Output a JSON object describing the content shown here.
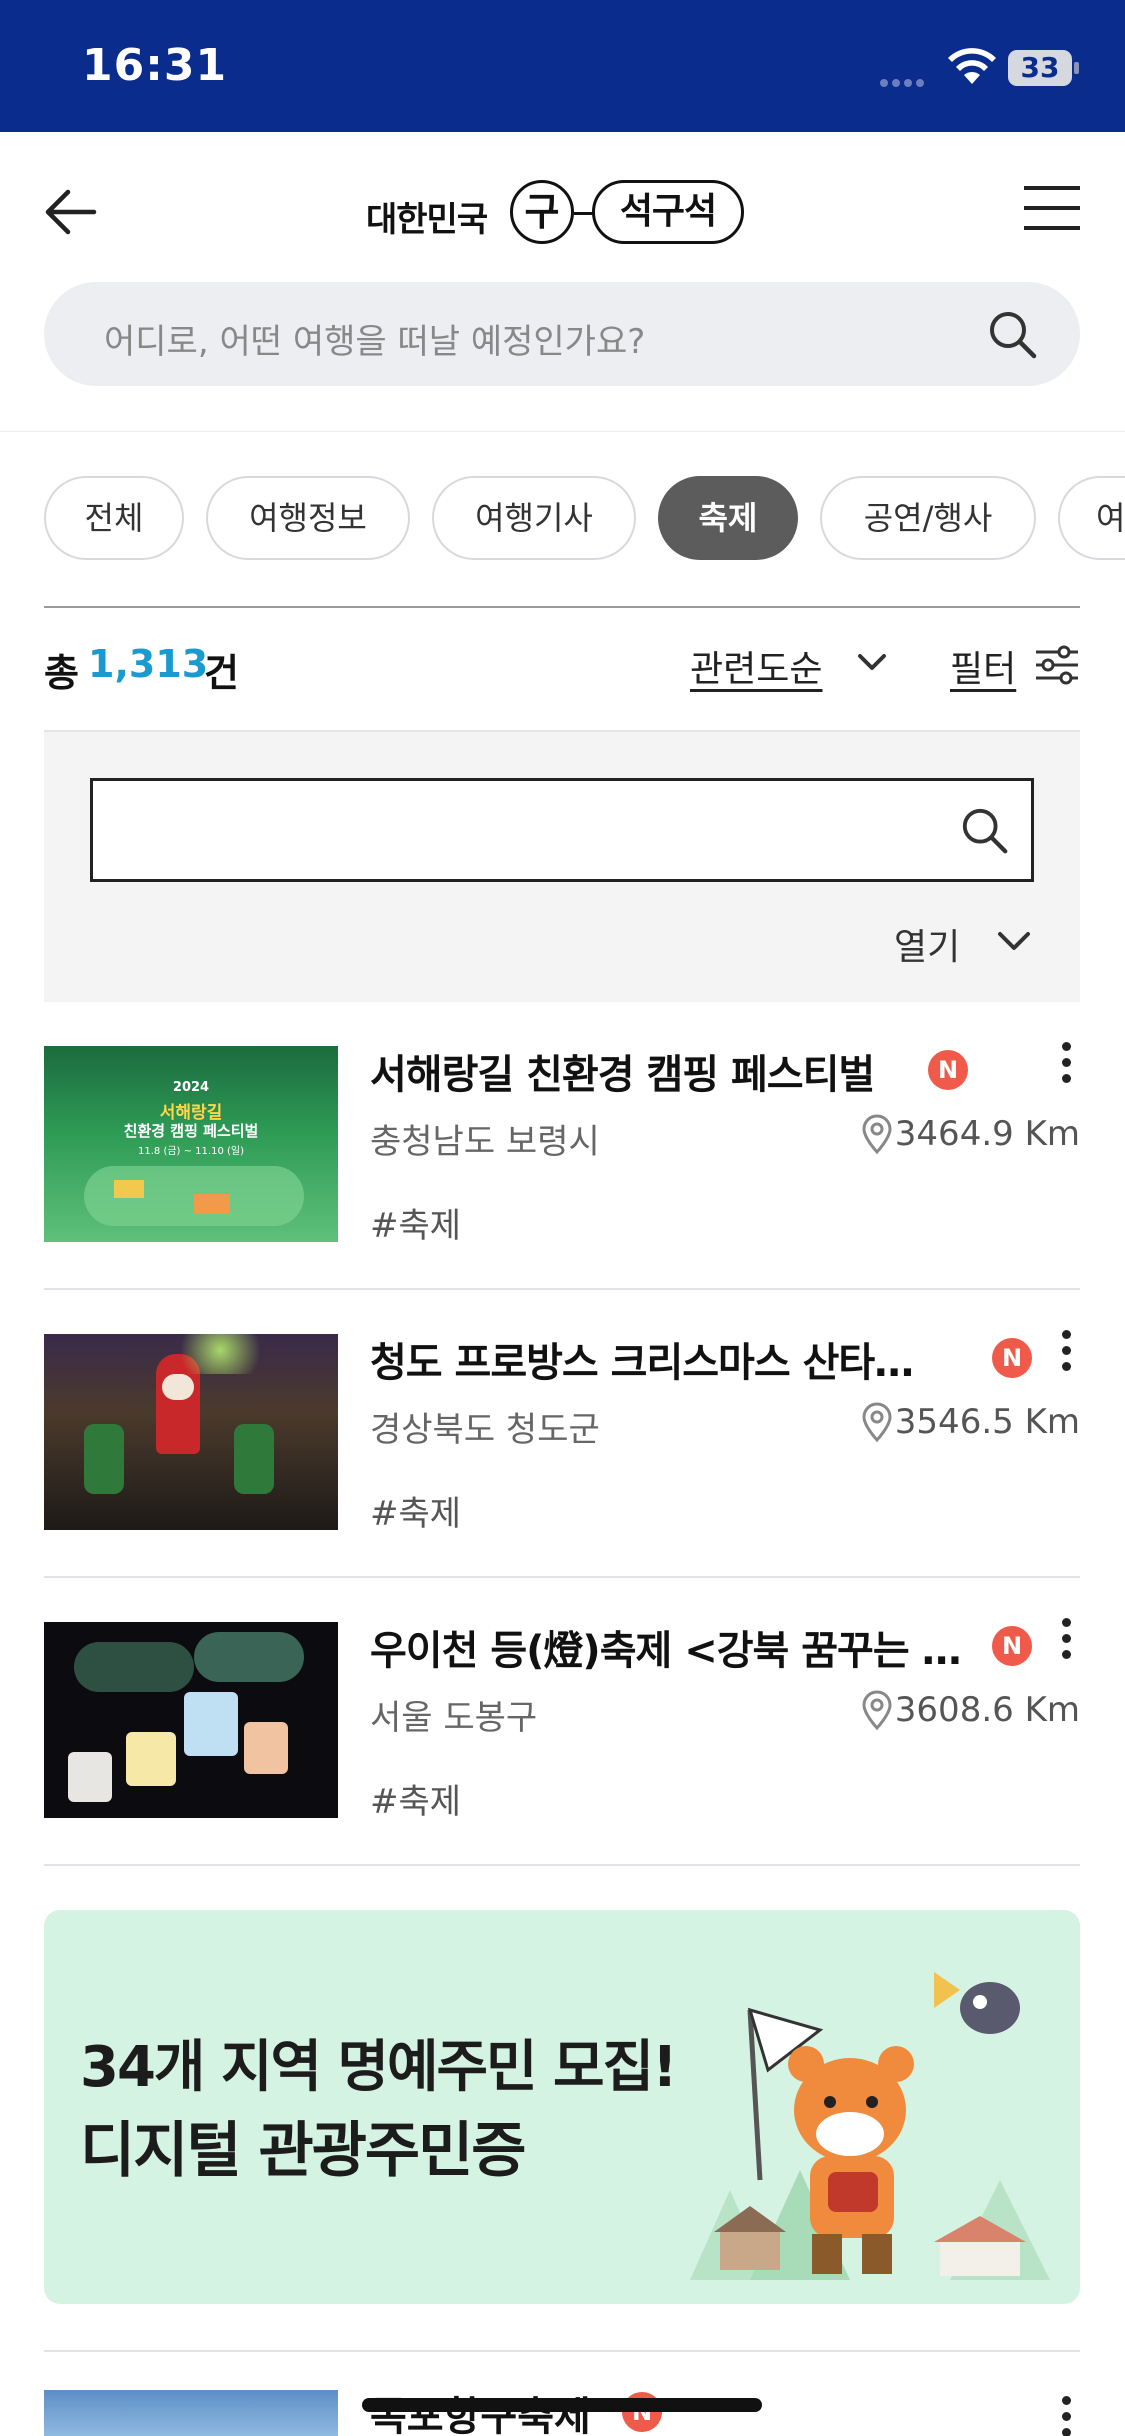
{
  "status_bar": {
    "time": "16:31",
    "battery": "33"
  },
  "header": {
    "logo_prefix": "대한민국",
    "logo_circle": "구",
    "logo_pill": "석구석",
    "search_placeholder": "어디로, 어떤 여행을 떠날 예정인가요?"
  },
  "chips": [
    {
      "label": "전체",
      "active": false
    },
    {
      "label": "여행정보",
      "active": false
    },
    {
      "label": "여행기사",
      "active": false
    },
    {
      "label": "축제",
      "active": true
    },
    {
      "label": "공연/행사",
      "active": false
    },
    {
      "label": "여",
      "active": false
    }
  ],
  "results": {
    "count_prefix": "총",
    "count": "1,313",
    "count_suffix": "건",
    "sort_label": "관련도순",
    "filter_label": "필터",
    "expand_label": "열기"
  },
  "items": [
    {
      "title": "서해랑길 친환경 캠핑 페스티벌",
      "badge": "N",
      "region": "충청남도 보령시",
      "distance": "3464.9 Km",
      "tag": "#축제",
      "thumb_caption_year": "2024",
      "thumb_caption_title": "서해랑길",
      "thumb_caption_sub": "친환경 캠핑 페스티벌",
      "thumb_caption_dates": "11.8 (금) ~ 11.10 (일)"
    },
    {
      "title": "청도 프로방스 크리스마스 산타…",
      "badge": "N",
      "region": "경상북도 청도군",
      "distance": "3546.5 Km",
      "tag": "#축제"
    },
    {
      "title": "우이천 등(燈)축제 <강북 꿈꾸는 …",
      "badge": "N",
      "region": "서울 도봉구",
      "distance": "3608.6 Km",
      "tag": "#축제"
    }
  ],
  "banner": {
    "line1": "34개 지역 명예주민 모집!",
    "line2": "디지털 관광주민증"
  },
  "last_item": {
    "title": "목포항구축제",
    "badge": "N"
  },
  "colors": {
    "status_bar": "#0a2c8c",
    "count_accent": "#1a9bcf",
    "badge": "#f05a4a",
    "banner_bg": "#d5f3e3",
    "chip_active": "#5c5c5c"
  }
}
